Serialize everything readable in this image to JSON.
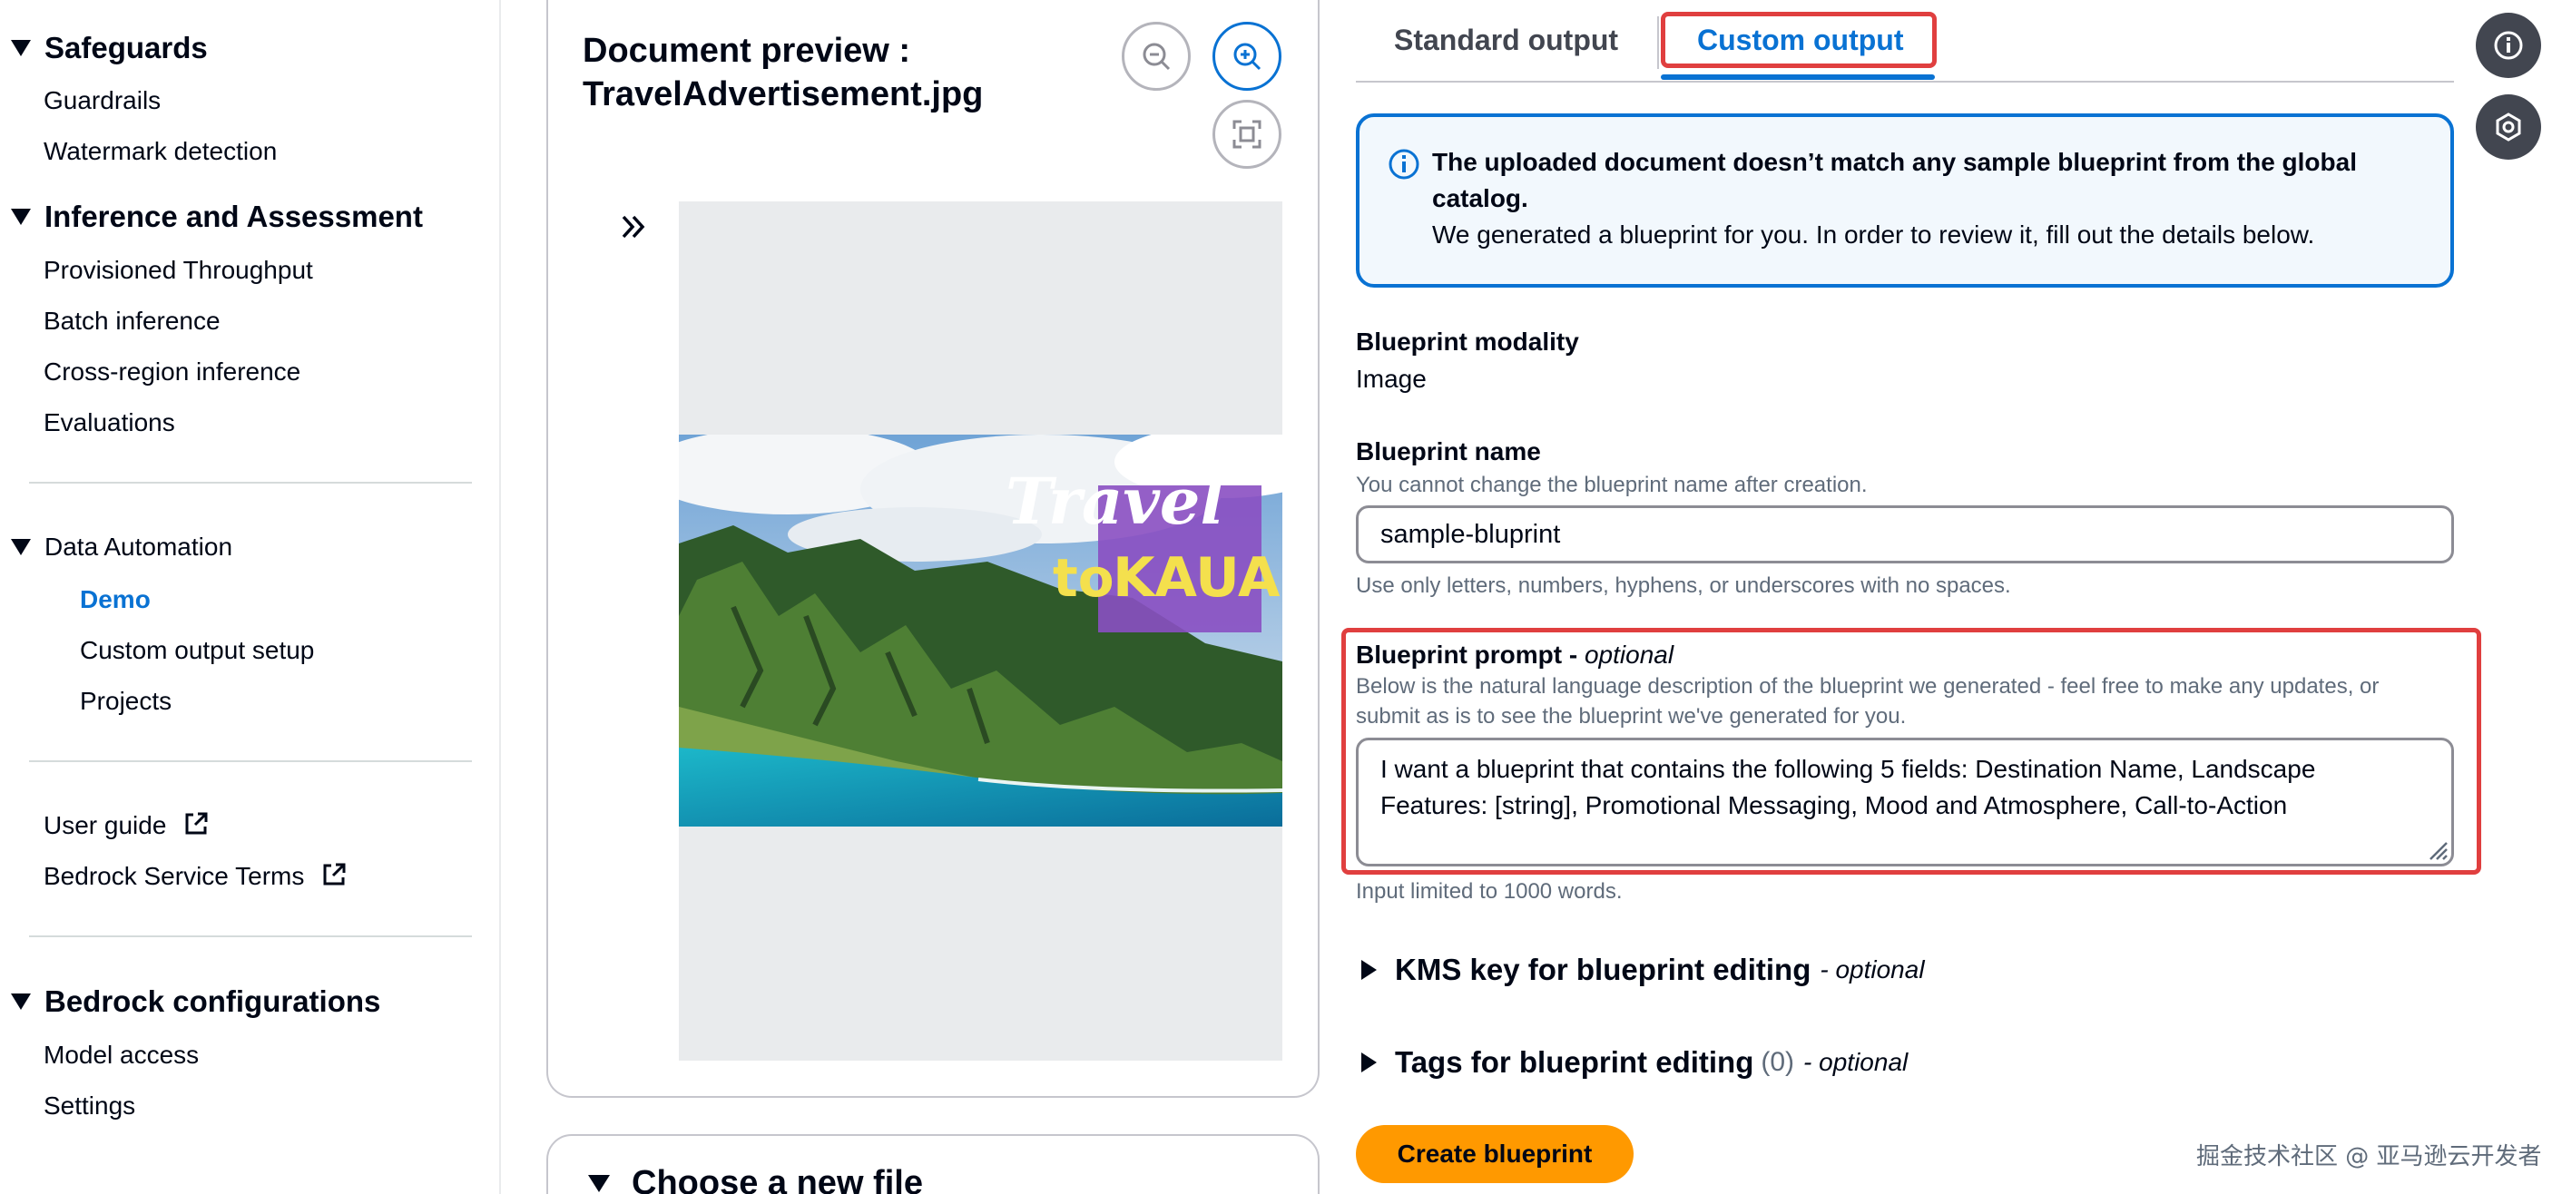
{
  "sidebar": {
    "safeguards": {
      "title": "Safeguards",
      "items": [
        "Guardrails",
        "Watermark detection"
      ]
    },
    "inference": {
      "title": "Inference and Assessment",
      "items": [
        "Provisioned Throughput",
        "Batch inference",
        "Cross-region inference",
        "Evaluations"
      ]
    },
    "data_automation": {
      "title": "Data Automation",
      "items": [
        "Demo",
        "Custom output setup",
        "Projects"
      ],
      "active": "Demo"
    },
    "links": [
      "User guide",
      "Bedrock Service Terms"
    ],
    "bedrock_config": {
      "title": "Bedrock configurations",
      "items": [
        "Model access",
        "Settings"
      ]
    }
  },
  "preview": {
    "title": "Document preview : TravelAdvertisement.jpg",
    "zoom_out_icon": "zoom-out-icon",
    "zoom_in_icon": "zoom-in-icon",
    "fit_icon": "fit-to-screen-icon",
    "image_text_line1": "Travel",
    "image_text_line2_a": "to",
    "image_text_line2_b": "KAUAI"
  },
  "file_section": {
    "title": "Choose a new file"
  },
  "tabs": {
    "standard": "Standard output",
    "custom": "Custom output",
    "active": "Custom output"
  },
  "alert": {
    "bold_text": "The uploaded document doesn’t match any sample blueprint from the global catalog.",
    "text": "We generated a blueprint for you. In order to review it, fill out the details below."
  },
  "form": {
    "modality_label": "Blueprint modality",
    "modality_value": "Image",
    "name_label": "Blueprint name",
    "name_desc": "You cannot change the blueprint name after creation.",
    "name_value": "sample-bluprint",
    "name_hint": "Use only letters, numbers, hyphens, or underscores with no spaces.",
    "prompt_label": "Blueprint prompt",
    "prompt_optional": "optional",
    "prompt_desc": "Below is the natural language description of the blueprint we generated - feel free to make any updates, or submit as is to see the blueprint we've generated for you.",
    "prompt_value": "I want a blueprint that contains the following 5 fields: Destination Name, Landscape Features: [string], Promotional Messaging, Mood and Atmosphere, Call-to-Action",
    "prompt_hint": "Input limited to 1000 words.",
    "kms_label": "KMS key for blueprint editing",
    "kms_optional": "optional",
    "tags_label": "Tags for blueprint editing",
    "tags_count": "(0)",
    "tags_optional": "optional",
    "create_button": "Create blueprint"
  },
  "rail": {
    "info_icon": "info-icon",
    "help_icon": "help-panel-icon"
  },
  "watermark": "掘金技术社区 @ 亚马逊云开发者",
  "colors": {
    "accent": "#0972d3",
    "highlight": "#e03f3f",
    "primary_button": "#ff9900"
  }
}
